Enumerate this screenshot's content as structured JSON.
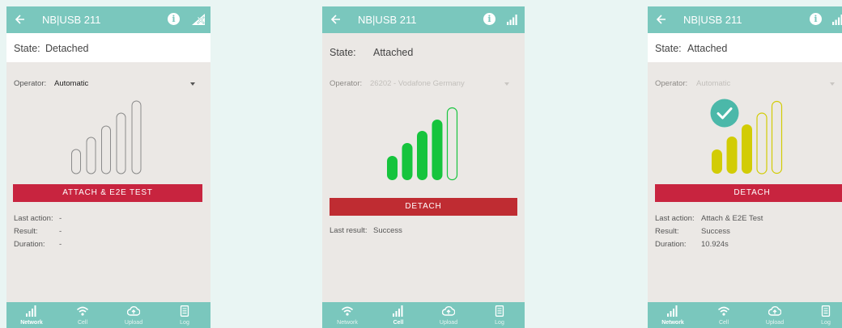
{
  "screens": [
    {
      "app_title": "NB|USB 211",
      "state_label": "State:",
      "state_value": "Detached",
      "operator_label": "Operator:",
      "operator_value": "Automatic",
      "signal_status": "no-signal",
      "button_label": "ATTACH & E2E TEST",
      "results": [
        {
          "label": "Last action:",
          "value": "-"
        },
        {
          "label": "Result:",
          "value": "-"
        },
        {
          "label": "Duration:",
          "value": "-"
        }
      ],
      "active_tab": "Network"
    },
    {
      "app_title": "NB|USB 211",
      "state_label": "State:",
      "state_value": "Attached",
      "operator_label": "Operator:",
      "operator_value": "26202 - Vodafone Germany",
      "signal_status": "4-of-5-green",
      "button_label": "DETACH",
      "results": [
        {
          "label": "Last result:",
          "value": "Success"
        }
      ],
      "active_tab": "Cell"
    },
    {
      "app_title": "NB|USB 211",
      "state_label": "State:",
      "state_value": "Attached",
      "operator_label": "Operator:",
      "operator_value": "Automatic",
      "signal_status": "3-of-5-yellow",
      "button_label": "DETACH",
      "results": [
        {
          "label": "Last action:",
          "value": "Attach & E2E Test"
        },
        {
          "label": "Result:",
          "value": "Success"
        },
        {
          "label": "Duration:",
          "value": "10.924s"
        }
      ],
      "active_tab": "Network"
    }
  ],
  "nav_tabs": [
    "Network",
    "Cell",
    "Upload",
    "Log"
  ],
  "colors": {
    "appbar": "#7ac7bd",
    "button_red": "#c8243f",
    "signal_green": "#16c43d",
    "signal_yellow": "#d2cc05",
    "check_teal": "#4bb8a9",
    "panel_bg": "#ebe8e5"
  },
  "icons": [
    "back-arrow-icon",
    "info-icon",
    "signal-icon",
    "no-signal-icon",
    "check-icon",
    "network-icon",
    "wifi-icon",
    "upload-cloud-icon",
    "log-icon",
    "dropdown-caret-icon"
  ]
}
